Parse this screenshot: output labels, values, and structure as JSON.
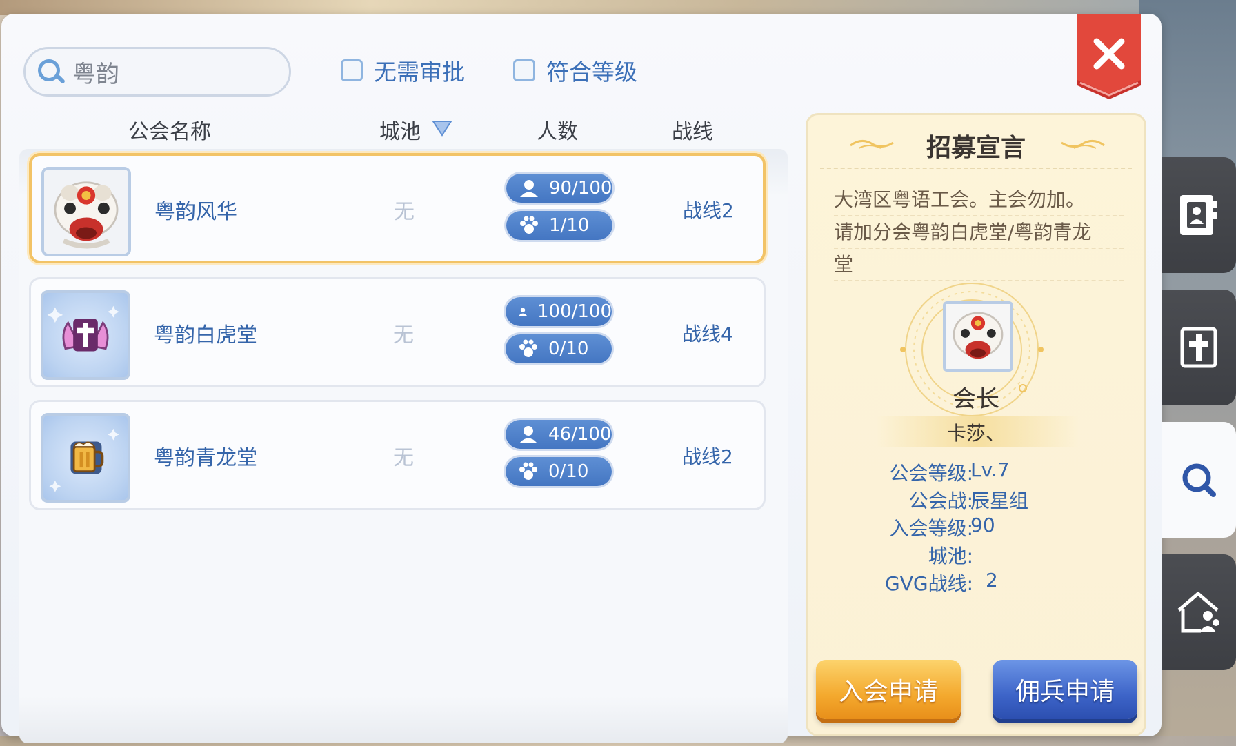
{
  "search": {
    "value": "粤韵"
  },
  "filters": [
    {
      "label": "无需审批",
      "checked": false
    },
    {
      "label": "符合等级",
      "checked": false
    }
  ],
  "columns": {
    "name": "公会名称",
    "city": "城池",
    "members": "人数",
    "line": "战线"
  },
  "guilds": [
    {
      "name": "粤韵风华",
      "city": "无",
      "members": "90/100",
      "pets": "1/10",
      "line": "战线2",
      "selected": true,
      "emblem": "lion-dance-icon"
    },
    {
      "name": "粤韵白虎堂",
      "city": "无",
      "members": "100/100",
      "pets": "0/10",
      "line": "战线4",
      "selected": false,
      "emblem": "winged-cross-icon"
    },
    {
      "name": "粤韵青龙堂",
      "city": "无",
      "members": "46/100",
      "pets": "0/10",
      "line": "战线2",
      "selected": false,
      "emblem": "beer-mug-icon"
    }
  ],
  "recruit": {
    "title": "招募宣言",
    "description": [
      "大湾区粤语工会。主会勿加。",
      "请加分会粤韵白虎堂/粤韵青龙",
      "堂"
    ],
    "leader_role": "会长",
    "leader_name": "卡莎、",
    "info": [
      {
        "key": "公会等级:",
        "value": "Lv.7"
      },
      {
        "key": "公会战:",
        "value": "辰星组"
      },
      {
        "key": "入会等级:",
        "value": "90"
      },
      {
        "key": "城池:",
        "value": ""
      },
      {
        "key": "GVG战线:",
        "value": "2"
      }
    ],
    "join_label": "入会申请",
    "merc_label": "佣兵申请"
  },
  "colors": {
    "accent_blue": "#3565aa",
    "gold": "#f4a92e",
    "selected_border": "#f2c366"
  }
}
